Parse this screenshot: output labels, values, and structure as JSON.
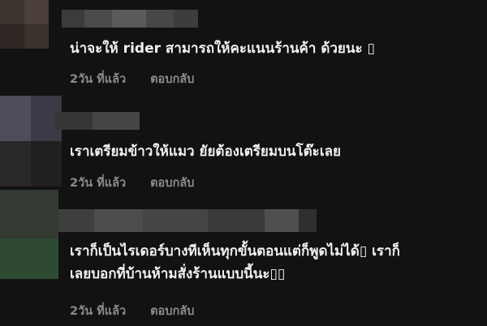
{
  "comments": [
    {
      "text_lines": [
        "น่าจะให้ rider สามารถให้คะแนนร้านค้า ด้วยนะ ▯"
      ],
      "time": "2วัน ที่แล้ว",
      "reply_label": "ตอบกลับ"
    },
    {
      "text_lines": [
        "เราเตรียมข้าวให้แมว ยัยต้องเตรียมบนโต๊ะเลย"
      ],
      "time": "2วัน ที่แล้ว",
      "reply_label": "ตอบกลับ"
    },
    {
      "text_lines": [
        "เราก็เป็นไรเดอร์บางทีเห็นทุกขั้นตอนแต่ก็พูดไม่ได้▯ เราก็",
        "เลยบอกที่บ้านห้ามสั่งร้านแบบนี้นะ▯▯"
      ],
      "time": "2วัน ที่แล้ว",
      "reply_label": "ตอบกลับ"
    }
  ]
}
